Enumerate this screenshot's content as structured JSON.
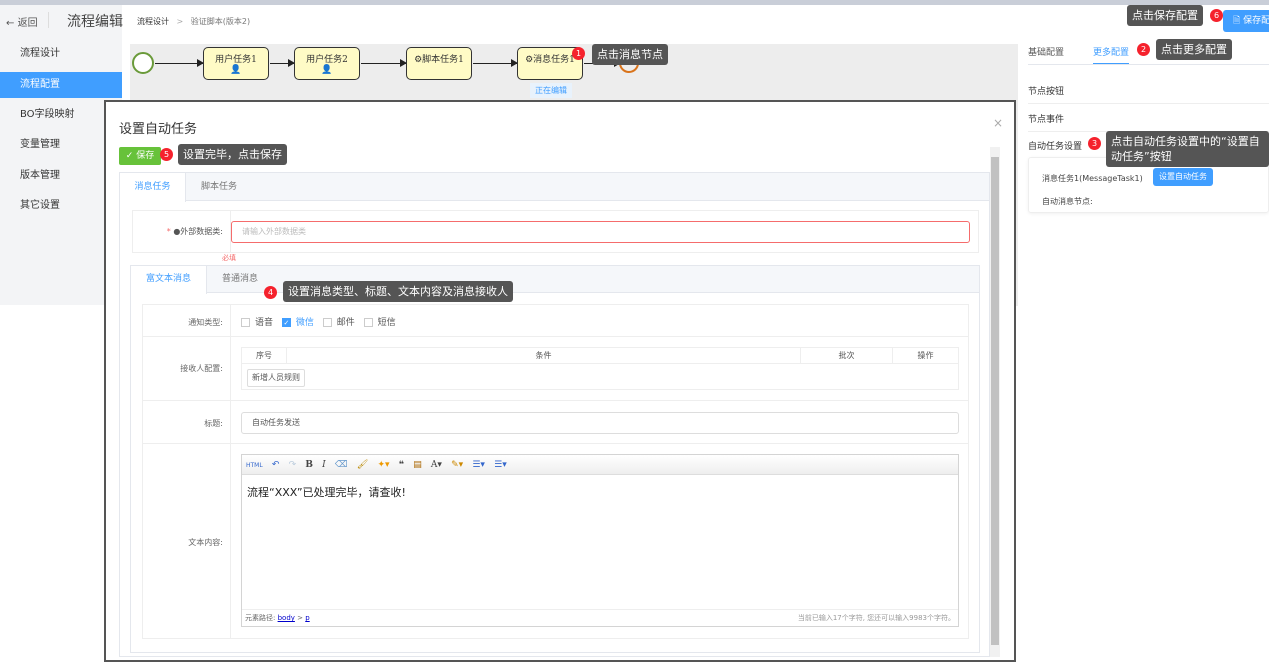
{
  "header": {
    "back_label": "返回",
    "title": "流程编辑",
    "breadcrumb": [
      "流程设计",
      "验证脚本(版本2)"
    ],
    "save_config_label": "保存配置"
  },
  "sidebar": {
    "items": [
      {
        "label": "流程设计"
      },
      {
        "label": "流程配置",
        "active": true
      },
      {
        "label": "BO字段映射"
      },
      {
        "label": "变量管理"
      },
      {
        "label": "版本管理"
      },
      {
        "label": "其它设置"
      }
    ]
  },
  "canvas": {
    "nodes": [
      "用户任务1",
      "用户任务2",
      "脚本任务1",
      "消息任务1"
    ],
    "editing_label": "正在编辑"
  },
  "right_panel": {
    "tabs": [
      "基础配置",
      "更多配置"
    ],
    "sections": [
      "节点按钮",
      "节点事件",
      "自动任务设置"
    ],
    "task_name": "消息任务1(MessageTask1)",
    "set_auto_task_button": "设置自动任务",
    "auto_msg_node_label": "自动消息节点:"
  },
  "tips": {
    "t1": "点击消息节点",
    "t2": "点击更多配置",
    "t3": "点击自动任务设置中的“设置自动任务”按钮",
    "t4": "设置消息类型、标题、文本内容及消息接收人",
    "t5": "设置完毕，点击保存",
    "t6": "点击保存配置"
  },
  "badges": [
    "1",
    "2",
    "3",
    "4",
    "5",
    "6"
  ],
  "modal": {
    "title": "设置自动任务",
    "close": "×",
    "save_label": "保存",
    "tabs": [
      "消息任务",
      "脚本任务"
    ],
    "external_label": "外部数据类:",
    "external_placeholder": "请输入外部数据类",
    "required_msg": "必填",
    "msg_tabs": [
      "富文本消息",
      "普通消息"
    ],
    "notify_label": "通知类型:",
    "notify_options": [
      {
        "label": "语音",
        "checked": false
      },
      {
        "label": "微信",
        "checked": true
      },
      {
        "label": "邮件",
        "checked": false
      },
      {
        "label": "短信",
        "checked": false
      }
    ],
    "receiver_label": "接收人配置:",
    "receiver_columns": [
      "序号",
      "条件",
      "批次",
      "操作"
    ],
    "add_rule_button": "新增人员规则",
    "subject_label": "标题:",
    "subject_value": "自动任务发送",
    "content_label": "文本内容:",
    "editor_content": "流程“XXX”已处理完毕，请查收!",
    "path_label": "元素路径:",
    "path_body": "body",
    "path_sep": ">",
    "path_p": "p",
    "char_count": "当前已输入17个字符, 您还可以输入9983个字符。"
  },
  "colors": {
    "primary": "#409eff",
    "success": "#67c23a",
    "danger": "#f5222d"
  }
}
